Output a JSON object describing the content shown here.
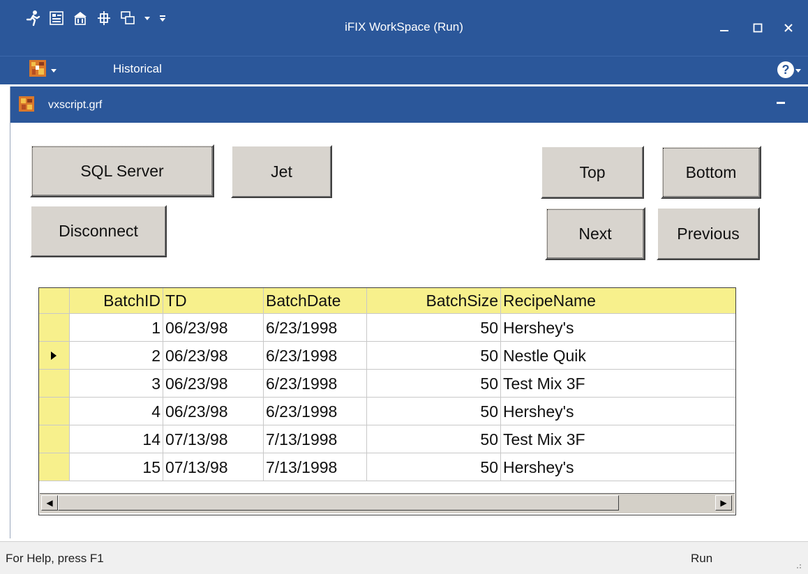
{
  "window": {
    "title": "iFIX WorkSpace (Run)",
    "quick_access": [
      "run-icon",
      "database-icon",
      "building-icon",
      "tag-icon",
      "windows-icon",
      "dropdown-icon",
      "customize-icon"
    ],
    "controls": {
      "minimize": "–",
      "maximize": "☐",
      "close": "✕"
    }
  },
  "ribbon": {
    "tab_label": "Historical",
    "help": "?"
  },
  "document": {
    "name": "vxscript.grf",
    "minimize": "–"
  },
  "buttons": {
    "sql_server": "SQL Server",
    "jet": "Jet",
    "disconnect": "Disconnect",
    "top": "Top",
    "bottom": "Bottom",
    "next": "Next",
    "previous": "Previous"
  },
  "table": {
    "columns": [
      "BatchID",
      "TD",
      "BatchDate",
      "BatchSize",
      "RecipeName"
    ],
    "rows": [
      [
        "1",
        "06/23/98",
        "6/23/1998",
        "50",
        "Hershey's"
      ],
      [
        "2",
        "06/23/98",
        "6/23/1998",
        "50",
        "Nestle Quik"
      ],
      [
        "3",
        "06/23/98",
        "6/23/1998",
        "50",
        "Test Mix 3F"
      ],
      [
        "4",
        "06/23/98",
        "6/23/1998",
        "50",
        "Hershey's"
      ],
      [
        "14",
        "07/13/98",
        "7/13/1998",
        "50",
        "Test Mix 3F"
      ],
      [
        "15",
        "07/13/98",
        "7/13/1998",
        "50",
        "Hershey's"
      ]
    ],
    "selected_row": 1,
    "scroll_left": "◀",
    "scroll_right": "▶"
  },
  "status": {
    "help": "For Help, press F1",
    "mode": "Run"
  },
  "colors": {
    "titlebar": "#2b579a",
    "grid_header": "#f7f08c",
    "button_face": "#d8d4ce"
  }
}
